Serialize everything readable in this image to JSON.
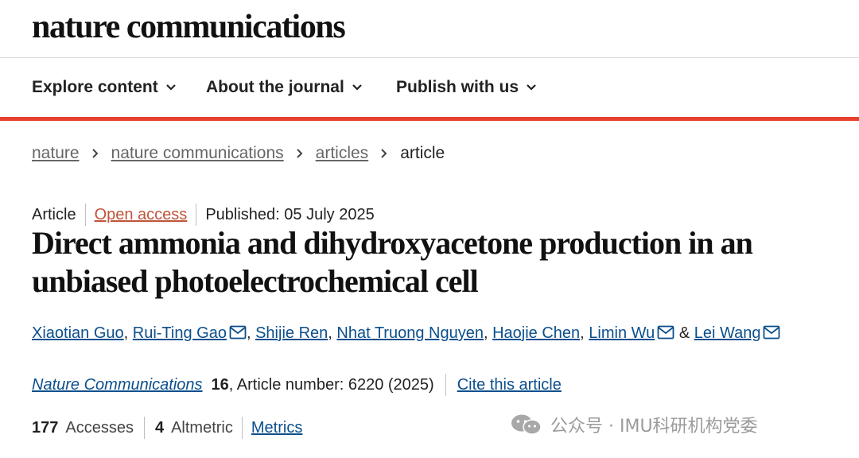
{
  "site": {
    "logo": "nature communications"
  },
  "nav": {
    "items": [
      {
        "label": "Explore content"
      },
      {
        "label": "About the journal"
      },
      {
        "label": "Publish with us"
      }
    ]
  },
  "colors": {
    "accent_bar": "#e8412d",
    "link": "#0b4f8c",
    "open_access": "#c0543a"
  },
  "breadcrumb": {
    "items": [
      "nature",
      "nature communications",
      "articles"
    ],
    "current": "article"
  },
  "article": {
    "type": "Article",
    "access": "Open access",
    "published": "Published: 05 July 2025",
    "title": "Direct ammonia and dihydroxyacetone production in an unbiased photoelectrochemical cell",
    "authors": [
      {
        "name": "Xiaotian Guo",
        "sep": ", ",
        "has_email": false
      },
      {
        "name": "Rui-Ting Gao",
        "sep": ", ",
        "has_email": true
      },
      {
        "name": "Shijie Ren",
        "sep": ", ",
        "has_email": false
      },
      {
        "name": "Nhat Truong Nguyen",
        "sep": ", ",
        "has_email": false
      },
      {
        "name": "Haojie Chen",
        "sep": ", ",
        "has_email": false
      },
      {
        "name": "Limin Wu",
        "sep": " & ",
        "has_email": true
      },
      {
        "name": "Lei Wang",
        "sep": "",
        "has_email": true
      }
    ],
    "journal": "Nature Communications",
    "volume": "16",
    "article_number": ", Article number: 6220 (2025)",
    "cite_label": "Cite this article"
  },
  "metrics": {
    "accesses_count": "177",
    "accesses_label": "Accesses",
    "altmetric_count": "4",
    "altmetric_label": "Altmetric",
    "metrics_link": "Metrics"
  },
  "watermark": {
    "text": "公众号 · IMU科研机构党委",
    "icon": "wechat-icon"
  }
}
